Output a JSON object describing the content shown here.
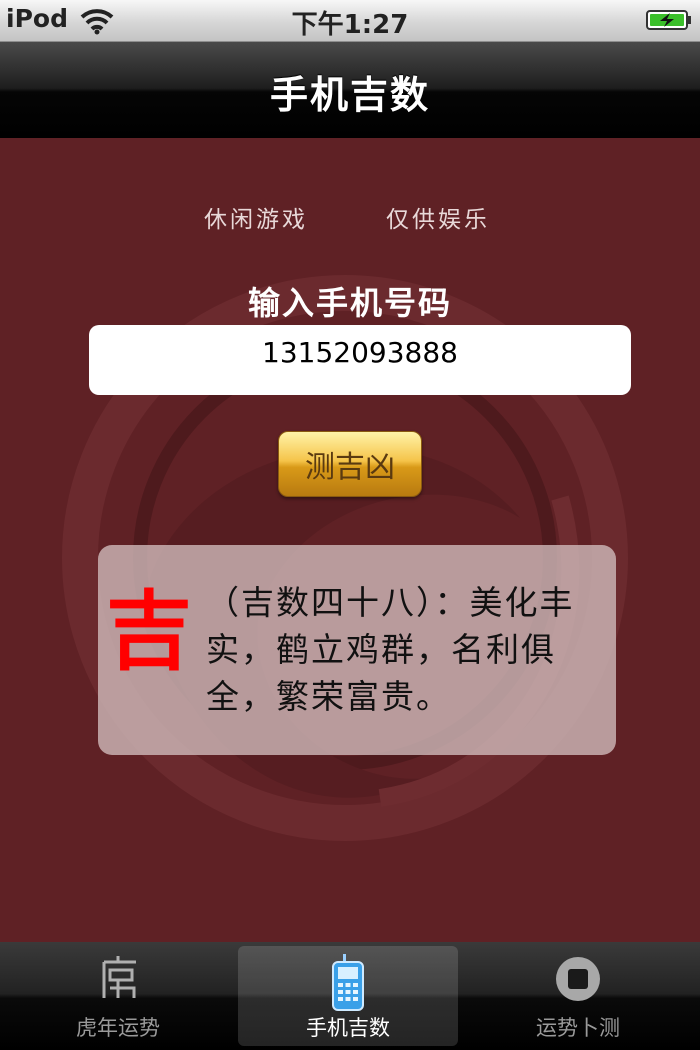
{
  "status_bar": {
    "carrier": "iPod",
    "time": "下午1:27"
  },
  "nav": {
    "title": "手机吉数"
  },
  "content": {
    "tagline_left": "休闲游戏",
    "tagline_right": "仅供娱乐",
    "input_label": "输入手机号码",
    "phone_number": "13152093888",
    "button_label": "测吉凶",
    "result": {
      "verdict": "吉",
      "description": "（吉数四十八）：美化丰实，鹤立鸡群，名利俱全，繁荣富贵。",
      "verdict_color": "#ff0000"
    }
  },
  "tabs": [
    {
      "label": "虎年运势",
      "icon": "tiger-character-icon",
      "active": false
    },
    {
      "label": "手机吉数",
      "icon": "mobile-phone-icon",
      "active": true
    },
    {
      "label": "运势卜测",
      "icon": "stop-circle-icon",
      "active": false
    }
  ],
  "colors": {
    "background": "#5f2125",
    "button_gold": "#f5c44a"
  }
}
